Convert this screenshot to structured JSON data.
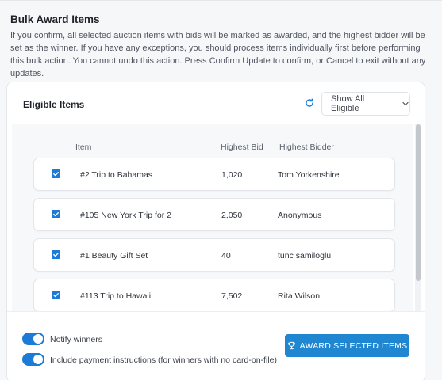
{
  "page": {
    "title": "Bulk Award Items",
    "description": "If you confirm, all selected auction items with bids will be marked as awarded, and the highest bidder will be set as the winner. If you have any exceptions, you should process items individually first before performing this bulk action. You cannot undo this action. Press Confirm Update to confirm, or Cancel to exit without any updates."
  },
  "card": {
    "title": "Eligible Items",
    "filter_label": "Show All Eligible"
  },
  "table": {
    "columns": [
      "Item",
      "Highest Bid",
      "Highest Bidder"
    ],
    "rows": [
      {
        "item": "#2 Trip to Bahamas",
        "bid": "1,020",
        "bidder": "Tom Yorkenshire",
        "checked": true
      },
      {
        "item": "#105 New York Trip for 2",
        "bid": "2,050",
        "bidder": "Anonymous",
        "checked": true
      },
      {
        "item": "#1 Beauty Gift Set",
        "bid": "40",
        "bidder": "tunc samiloglu",
        "checked": true
      },
      {
        "item": "#113 Trip to Hawaii",
        "bid": "7,502",
        "bidder": "Rita Wilson",
        "checked": true
      }
    ]
  },
  "options": {
    "notify_winners": {
      "label": "Notify winners",
      "on": true
    },
    "include_payment": {
      "label": "Include payment instructions (for winners with no card-on-file)",
      "on": true
    }
  },
  "actions": {
    "award_label": "AWARD SELECTED ITEMS"
  },
  "colors": {
    "accent": "#1c7bd6",
    "button": "#1f86d2"
  },
  "icons": [
    "refresh-icon",
    "chevron-down-icon",
    "checkmark-icon",
    "trophy-icon"
  ]
}
